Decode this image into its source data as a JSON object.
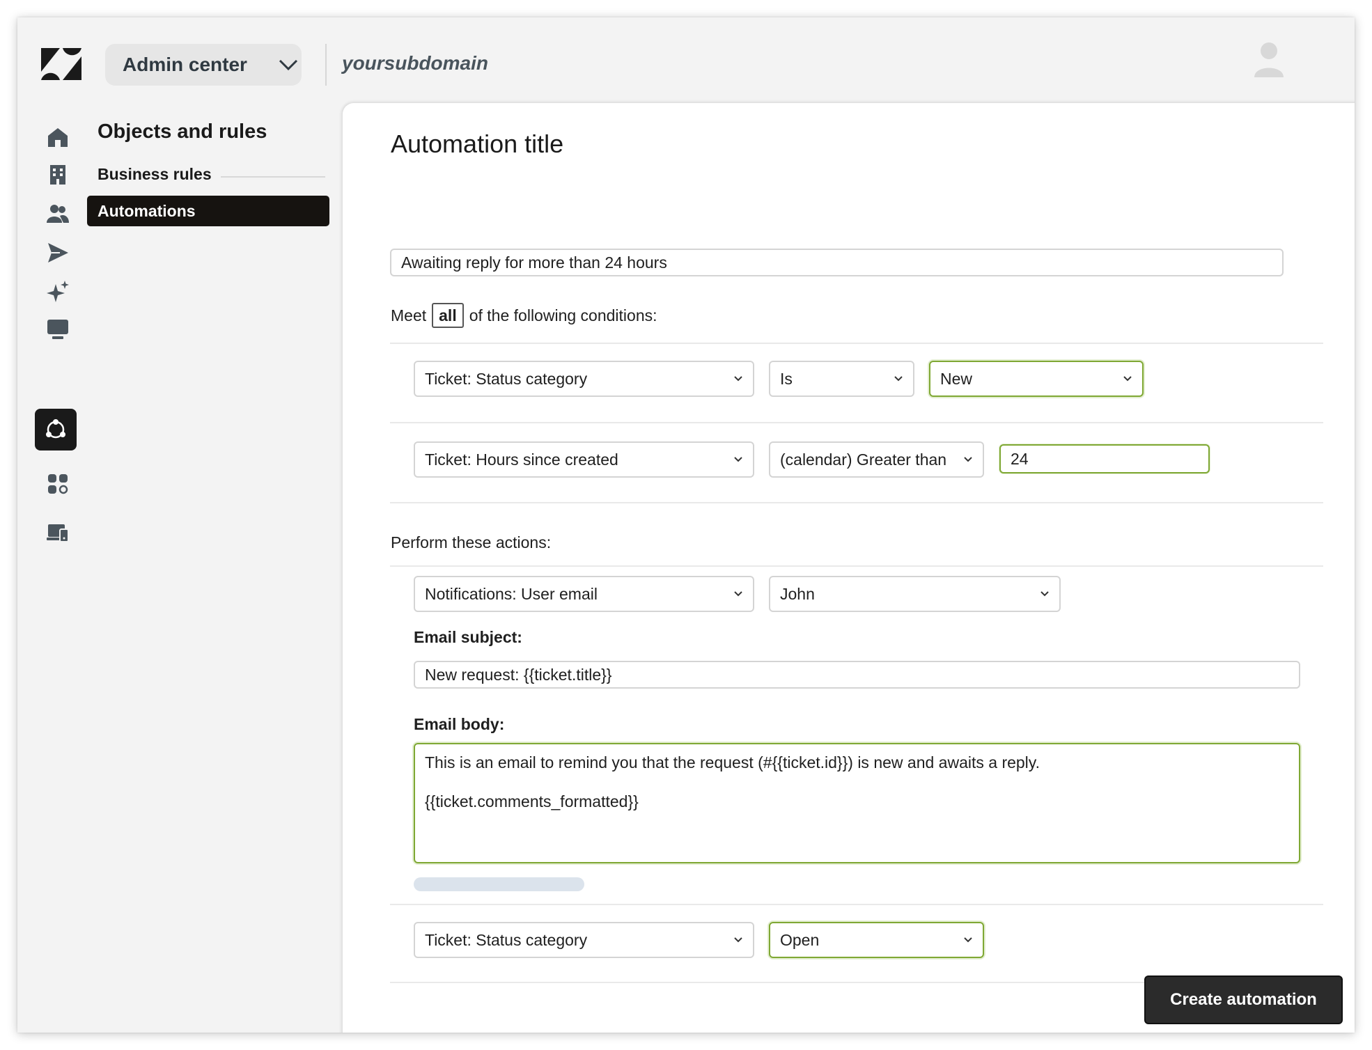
{
  "header": {
    "admin_center_label": "Admin center",
    "subdomain": "yoursubdomain"
  },
  "rail": {
    "icons": [
      "home-icon",
      "building-icon",
      "people-icon",
      "send-icon",
      "sparkle-icon",
      "monitor-icon",
      "objects-rules-icon",
      "apps-icon",
      "devices-icon"
    ],
    "active": "objects-rules-icon"
  },
  "nav": {
    "title": "Objects and rules",
    "section": "Business rules",
    "active_item": "Automations"
  },
  "form": {
    "title_heading": "Automation title",
    "title_value": "Awaiting reply for more than 24 hours",
    "meet_prefix": "Meet",
    "meet_value": "all",
    "meet_suffix": "of the following conditions:",
    "conditions": [
      {
        "field": "Ticket: Status category",
        "operator": "Is",
        "value": "New"
      },
      {
        "field": "Ticket: Hours since created",
        "operator": "(calendar) Greater than",
        "value": "24"
      }
    ],
    "actions_heading": "Perform these actions:",
    "actions": [
      {
        "field": "Notifications: User email",
        "value": "John"
      },
      {
        "field": "Ticket: Status category",
        "value": "Open"
      }
    ],
    "email_subject_label": "Email subject:",
    "email_subject_value": "New request: {{ticket.title}}",
    "email_body_label": "Email body:",
    "email_body_line1": "This is an email to remind you that the request (#{{ticket.id}}) is new and awaits a reply.",
    "email_body_line2": "{{ticket.comments_formatted}}",
    "submit_label": "Create automation"
  },
  "colors": {
    "accent_green": "#7fa834",
    "dark": "#161310"
  }
}
